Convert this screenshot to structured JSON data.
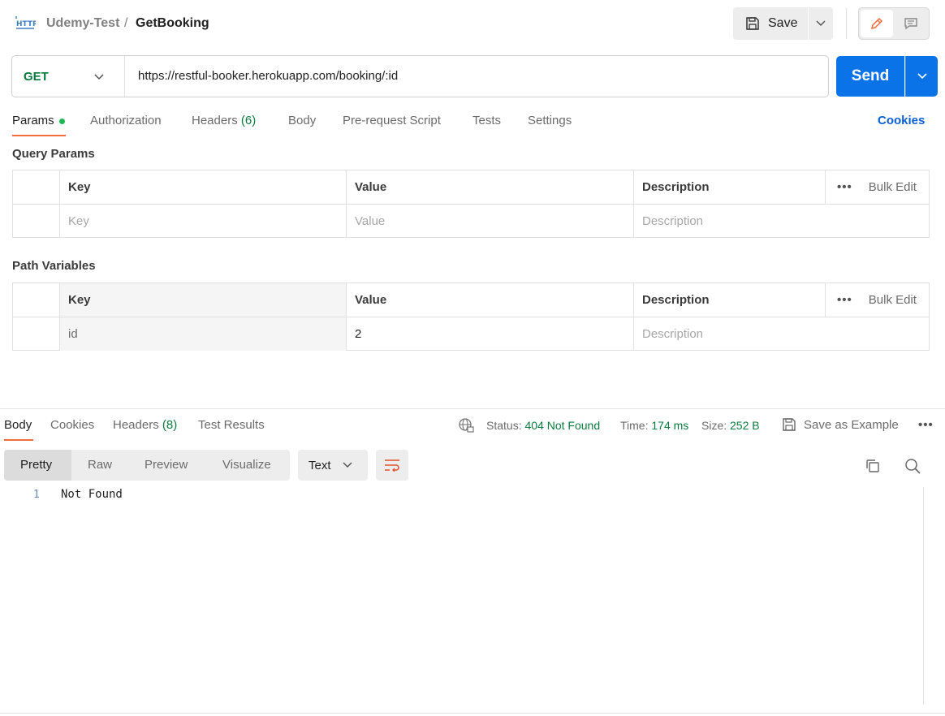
{
  "header": {
    "collection": "Udemy-Test",
    "separator": "/",
    "request_name": "GetBooking",
    "save_label": "Save",
    "http_icon": "http-file-icon"
  },
  "request": {
    "method": "GET",
    "url": "https://restful-booker.herokuapp.com/booking/:id",
    "send_label": "Send"
  },
  "tabs": [
    {
      "label": "Params"
    },
    {
      "label": "Authorization"
    },
    {
      "label": "Headers",
      "count": "(6)"
    },
    {
      "label": "Body"
    },
    {
      "label": "Pre-request Script"
    },
    {
      "label": "Tests"
    },
    {
      "label": "Settings"
    }
  ],
  "cookies_link": "Cookies",
  "query_params": {
    "title": "Query Params",
    "columns": [
      "Key",
      "Value",
      "Description"
    ],
    "bulk_edit": "Bulk Edit",
    "placeholders": {
      "key": "Key",
      "value": "Value",
      "description": "Description"
    }
  },
  "path_variables": {
    "title": "Path Variables",
    "columns": [
      "Key",
      "Value",
      "Description"
    ],
    "bulk_edit": "Bulk Edit",
    "rows": [
      {
        "key": "id",
        "value": "2",
        "description_placeholder": "Description"
      }
    ]
  },
  "response": {
    "tabs": [
      {
        "label": "Body"
      },
      {
        "label": "Cookies"
      },
      {
        "label": "Headers",
        "count": "(8)"
      },
      {
        "label": "Test Results"
      }
    ],
    "status_label": "Status:",
    "status_value": "404 Not Found",
    "time_label": "Time:",
    "time_value": "174 ms",
    "size_label": "Size:",
    "size_value": "252 B",
    "save_example": "Save as Example",
    "views": [
      "Pretty",
      "Raw",
      "Preview",
      "Visualize"
    ],
    "format": "Text",
    "body_lines": [
      {
        "no": "1",
        "text": "Not Found"
      }
    ]
  },
  "colors": {
    "send": "#0b73e8",
    "method_get": "#0a7a3e",
    "accent": "#f26b3a",
    "link": "#0b5fcf"
  }
}
